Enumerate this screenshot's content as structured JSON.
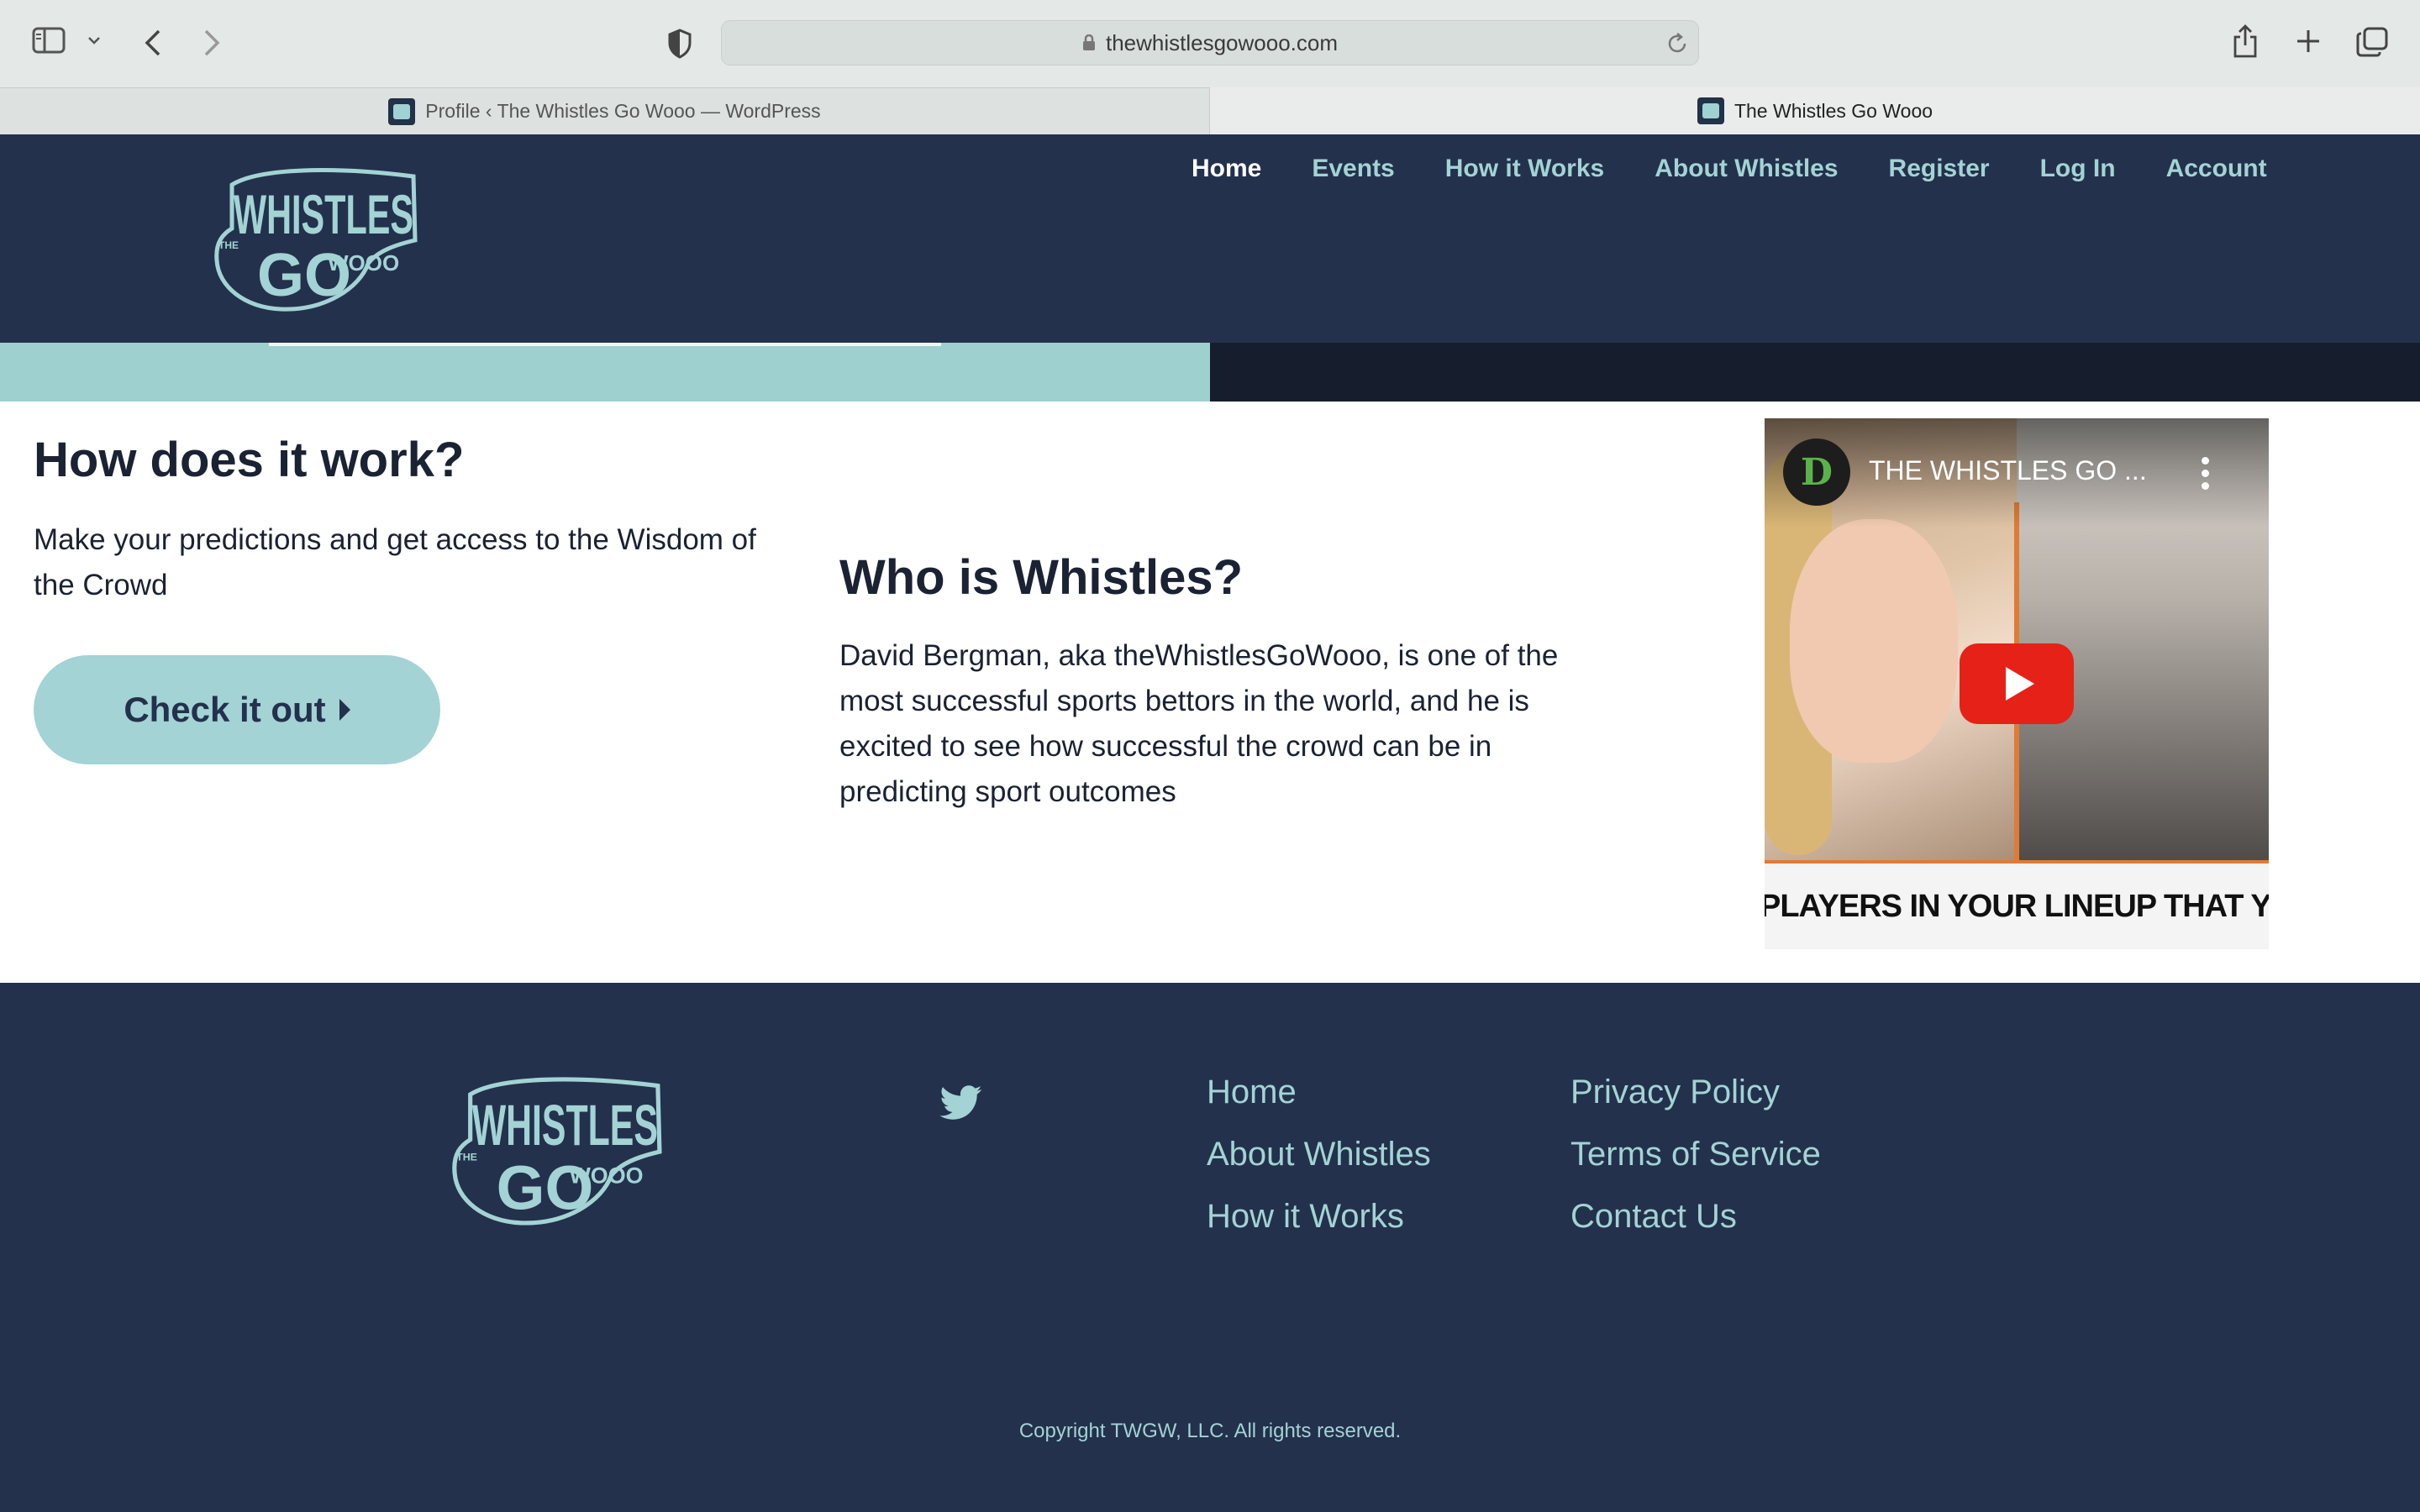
{
  "browser": {
    "url": "thewhistlesgowooo.com",
    "tabs": [
      {
        "title": "Profile ‹ The Whistles Go Wooo — WordPress"
      },
      {
        "title": "The Whistles Go Wooo"
      }
    ]
  },
  "logo": {
    "line1": "WHISTLES",
    "line2": "GO",
    "small_top": "THE",
    "small_right": "WOOO"
  },
  "nav": {
    "items": [
      {
        "label": "Home",
        "active": true
      },
      {
        "label": "Events"
      },
      {
        "label": "How it Works"
      },
      {
        "label": "About Whistles"
      },
      {
        "label": "Register"
      },
      {
        "label": "Log In"
      },
      {
        "label": "Account"
      }
    ]
  },
  "how": {
    "heading": "How does it work?",
    "body": "Make your predictions and get access to the Wisdom of the Crowd",
    "cta_label": "Check it out"
  },
  "who": {
    "heading": "Who is Whistles?",
    "body": "David Bergman, aka theWhistlesGoWooo, is one of the most successful sports bettors in the world, and he is excited to see how successful the crowd can be in predicting sport outcomes"
  },
  "video": {
    "title": "THE WHISTLES GO ...",
    "channel_initial": "D",
    "banner": "PLAYERS IN YOUR LINEUP THAT YOU WERE"
  },
  "footer": {
    "col1": [
      "Home",
      "About Whistles",
      "How it Works"
    ],
    "col2": [
      "Privacy Policy",
      "Terms of Service",
      "Contact Us"
    ],
    "copyright": "Copyright TWGW, LLC. All rights reserved."
  },
  "colors": {
    "navy": "#23314c",
    "teal": "#a3d3d4",
    "youtube_red": "#e62117"
  }
}
